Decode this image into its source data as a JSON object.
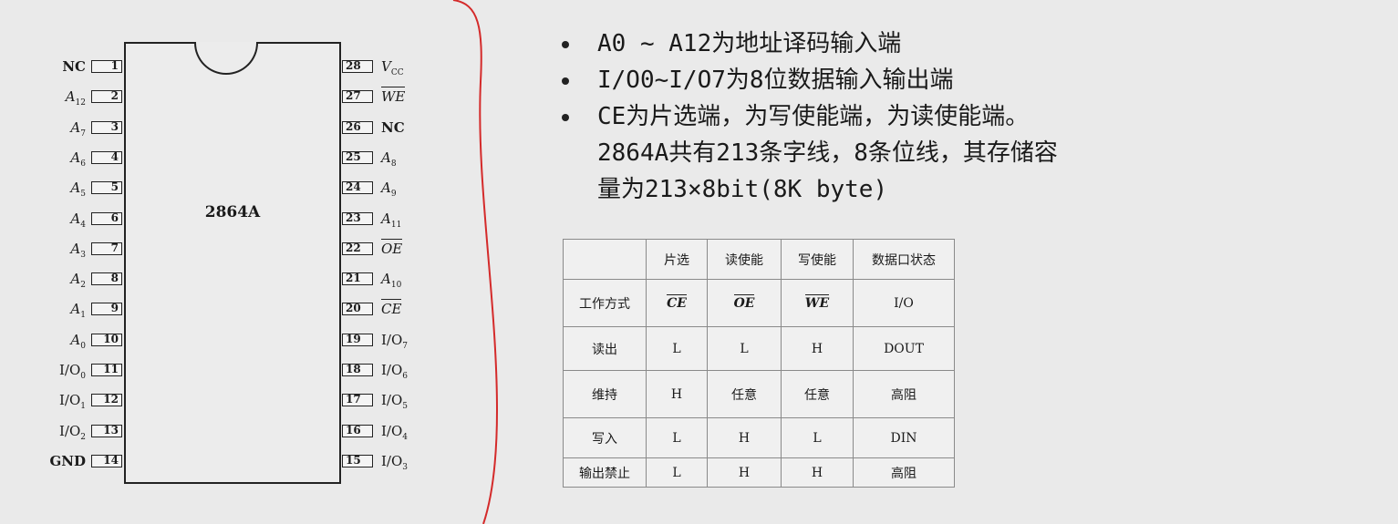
{
  "chip": {
    "name": "2864A",
    "left_pins": [
      {
        "num": "1",
        "name": "NC",
        "style": "bold"
      },
      {
        "num": "2",
        "name": "A",
        "sub": "12",
        "style": "italic"
      },
      {
        "num": "3",
        "name": "A",
        "sub": "7",
        "style": "italic"
      },
      {
        "num": "4",
        "name": "A",
        "sub": "6",
        "style": "italic"
      },
      {
        "num": "5",
        "name": "A",
        "sub": "5",
        "style": "italic"
      },
      {
        "num": "6",
        "name": "A",
        "sub": "4",
        "style": "italic"
      },
      {
        "num": "7",
        "name": "A",
        "sub": "3",
        "style": "italic"
      },
      {
        "num": "8",
        "name": "A",
        "sub": "2",
        "style": "italic"
      },
      {
        "num": "9",
        "name": "A",
        "sub": "1",
        "style": "italic"
      },
      {
        "num": "10",
        "name": "A",
        "sub": "0",
        "style": "italic"
      },
      {
        "num": "11",
        "name": "I/O",
        "sub": "0",
        "style": "normal"
      },
      {
        "num": "12",
        "name": "I/O",
        "sub": "1",
        "style": "normal"
      },
      {
        "num": "13",
        "name": "I/O",
        "sub": "2",
        "style": "normal"
      },
      {
        "num": "14",
        "name": "GND",
        "style": "bold"
      }
    ],
    "right_pins": [
      {
        "num": "28",
        "name": "V",
        "sub": "CC",
        "style": "italic"
      },
      {
        "num": "27",
        "name": "WE",
        "style": "italic-over"
      },
      {
        "num": "26",
        "name": "NC",
        "style": "bold"
      },
      {
        "num": "25",
        "name": "A",
        "sub": "8",
        "style": "italic"
      },
      {
        "num": "24",
        "name": "A",
        "sub": "9",
        "style": "italic"
      },
      {
        "num": "23",
        "name": "A",
        "sub": "11",
        "style": "italic"
      },
      {
        "num": "22",
        "name": "OE",
        "style": "italic-over"
      },
      {
        "num": "21",
        "name": "A",
        "sub": "10",
        "style": "italic"
      },
      {
        "num": "20",
        "name": "CE",
        "style": "italic-over"
      },
      {
        "num": "19",
        "name": "I/O",
        "sub": "7",
        "style": "normal"
      },
      {
        "num": "18",
        "name": "I/O",
        "sub": "6",
        "style": "normal"
      },
      {
        "num": "17",
        "name": "I/O",
        "sub": "5",
        "style": "normal"
      },
      {
        "num": "16",
        "name": "I/O",
        "sub": "4",
        "style": "normal"
      },
      {
        "num": "15",
        "name": "I/O",
        "sub": "3",
        "style": "normal"
      }
    ]
  },
  "bullets": [
    {
      "lines": [
        "A0 ~ A12为地址译码输入端"
      ]
    },
    {
      "lines": [
        "I/O0~I/O7为8位数据输入输出端"
      ]
    },
    {
      "lines": [
        "CE为片选端，为写使能端，为读使能端。",
        "2864A共有213条字线，8条位线，其存储容",
        "量为213×8bit(8K byte)"
      ]
    }
  ],
  "table": {
    "header": [
      "",
      "片选",
      "读使能",
      "写使能",
      "数据口状态"
    ],
    "signal_row": {
      "label": "工作方式",
      "cells": [
        "CE",
        "OE",
        "WE"
      ],
      "last": "I/O"
    },
    "rows": [
      [
        "读出",
        "L",
        "L",
        "H",
        "DOUT"
      ],
      [
        "维持",
        "H",
        "任意",
        "任意",
        "高阻"
      ],
      [
        "写入",
        "L",
        "H",
        "L",
        "DIN"
      ],
      [
        "输出禁止",
        "L",
        "H",
        "H",
        "高阻"
      ]
    ]
  },
  "colors": {
    "background": "#eaeaea",
    "curve": "#d42a2a",
    "ink": "#1a1a1a"
  }
}
